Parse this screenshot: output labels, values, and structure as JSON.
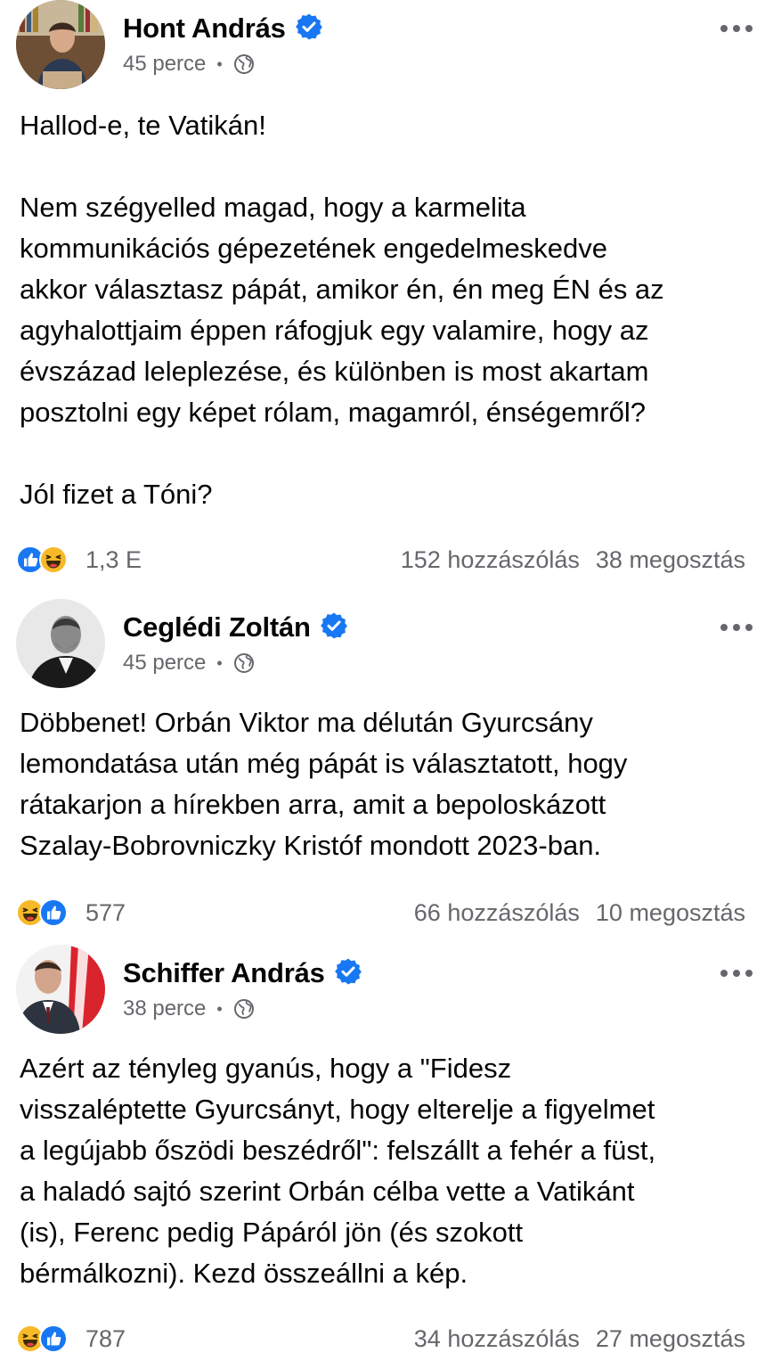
{
  "posts": [
    {
      "author": "Hont András",
      "time": "45 perce",
      "text": "Hallod-e, te Vatikán!\n\nNem szégyelled magad, hogy a karmelita\nkommunikációs gépezetének engedelmeskedve\nakkor választasz pápát, amikor én, én meg ÉN és az\nagyhalottjaim éppen ráfogjuk egy valamire, hogy az\névszázad leleplezése, és különben is most akartam\nposztolni egy képet rólam, magamról, énségemről?\n\nJól fizet a Tóni?",
      "reactions": [
        "like",
        "haha"
      ],
      "reaction_count": "1,3 E",
      "comments": "152 hozzászólás",
      "shares": "38 megosztás"
    },
    {
      "author": "Ceglédi Zoltán",
      "time": "45 perce",
      "text": "Döbbenet! Orbán Viktor ma délután Gyurcsány\nlemondatása után még pápát is választatott, hogy\nrátakarjon a hírekben arra, amit a bepoloskázott\nSzalay-Bobrovniczky Kristóf mondott 2023-ban.",
      "reactions": [
        "haha",
        "like"
      ],
      "reaction_count": "577",
      "comments": "66 hozzászólás",
      "shares": "10 megosztás"
    },
    {
      "author": "Schiffer András",
      "time": "38 perce",
      "text": "Azért az tényleg gyanús, hogy a \"Fidesz\nvisszaléptette Gyurcsányt, hogy elterelje a figyelmet\na legújabb őszödi beszédről\": felszállt a fehér a füst,\na haladó sajtó szerint Orbán célba vette a Vatikánt\n(is), Ferenc pedig Pápáról jön (és szokott\nbérmálkozni). Kezd összeállni a kép.",
      "reactions": [
        "haha",
        "like"
      ],
      "reaction_count": "787",
      "comments": "34 hozzászólás",
      "shares": "27 megosztás"
    }
  ],
  "icons": {
    "verified": "verified-badge-icon",
    "audience": "globe-icon",
    "more": "more-options-icon",
    "like": "like-reaction-icon",
    "haha": "haha-reaction-icon"
  },
  "colors": {
    "verified_blue": "#1877f2",
    "meta_gray": "#65676b",
    "haha_yellow": "#f7b928"
  }
}
